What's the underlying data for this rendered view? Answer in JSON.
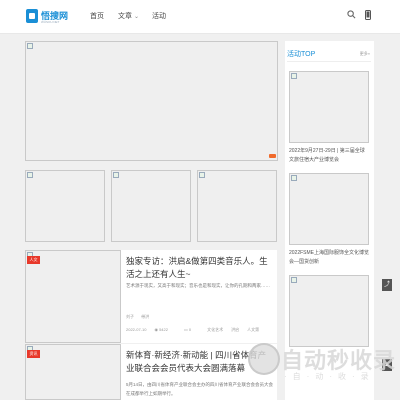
{
  "header": {
    "logo_text": "悟搜网",
    "logo_sub": "WUSOU.NET",
    "nav": [
      {
        "label": "首页"
      },
      {
        "label": "文章"
      },
      {
        "label": "活动"
      }
    ],
    "nav_dropdown_icon": "chevron-down-icon",
    "search_icon": "search-icon",
    "mobile_icon": "mobile-icon"
  },
  "sidebar": {
    "title": "活动TOP",
    "more": "更多»",
    "items": [
      {
        "caption": "2022年9月27日-29日 | 第三届全球文旅住宿大产业博览会"
      },
      {
        "caption": "2022FSME上海国际服饰全文化博览会—国货创新"
      }
    ]
  },
  "cards": [
    {
      "tag": "人文",
      "tag_color": "#e8382a",
      "title": "独家专访：洪启&做第四类音乐人。生活之上还有人生~",
      "desc": "艺术源于现实，又高于和现实；音乐也是和现实，让你的孔期和两家……",
      "author": "刘子",
      "author_extra": "带洪",
      "date": "2022-07-10",
      "views": "5422",
      "comments": "0",
      "category": "文化艺术",
      "extra1": "洪启",
      "extra2": "人文第"
    },
    {
      "tag": "资讯",
      "tag_color": "#e8382a",
      "title": "新体育·新经济·新动能 | 四川省体育产业联合会会员代表大会圆满落幕",
      "desc": "5月14日，由四川省体育产业联合会主办的四川省体育产业联合会会员大会在成都举行上如期举行。"
    }
  ],
  "side_buttons": [
    "share-icon",
    "up-icon"
  ],
  "watermark": {
    "text": "自动秒收录",
    "sub": "·自·动·收·录"
  }
}
